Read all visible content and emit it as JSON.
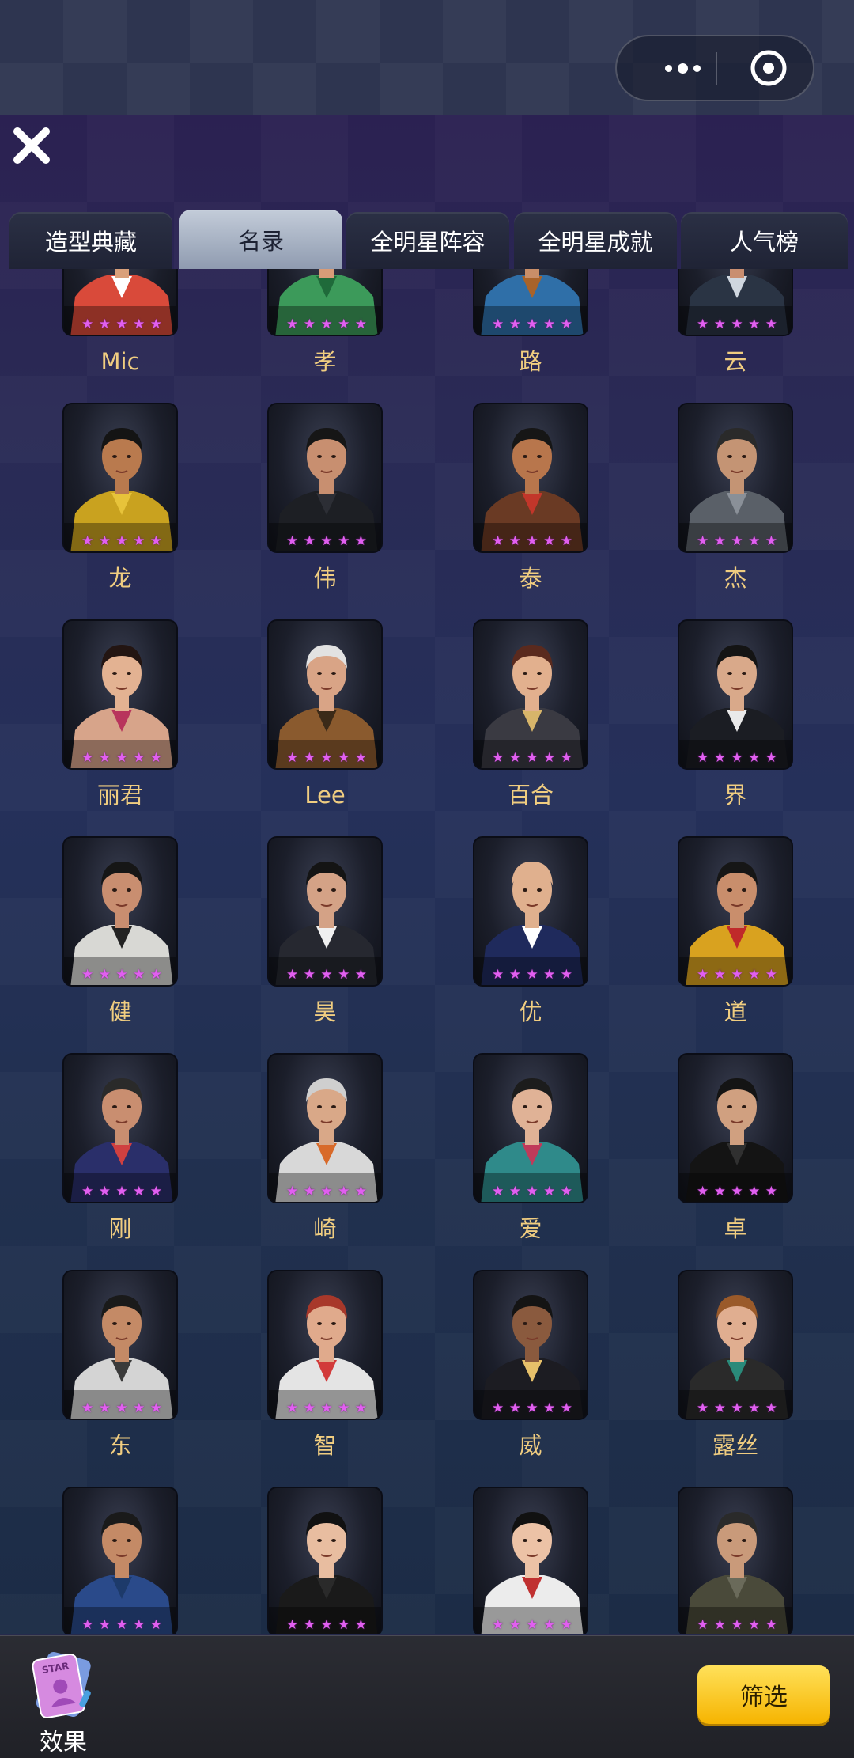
{
  "tabs": [
    {
      "label": "造型典藏"
    },
    {
      "label": "名录",
      "active": true
    },
    {
      "label": "全明星阵容"
    },
    {
      "label": "全明星成就"
    },
    {
      "label": "人气榜"
    }
  ],
  "star_rating": 5,
  "star_color": "#e15ff0",
  "characters": [
    {
      "name": "Mic"
    },
    {
      "name": "孝"
    },
    {
      "name": "路"
    },
    {
      "name": "云"
    },
    {
      "name": "龙"
    },
    {
      "name": "伟"
    },
    {
      "name": "泰"
    },
    {
      "name": "杰"
    },
    {
      "name": "丽君"
    },
    {
      "name": "Lee"
    },
    {
      "name": "百合"
    },
    {
      "name": "界"
    },
    {
      "name": "健"
    },
    {
      "name": "昊"
    },
    {
      "name": "优"
    },
    {
      "name": "道"
    },
    {
      "name": "刚"
    },
    {
      "name": "崎"
    },
    {
      "name": "爱"
    },
    {
      "name": "卓"
    },
    {
      "name": "东"
    },
    {
      "name": "智"
    },
    {
      "name": "威"
    },
    {
      "name": "露丝"
    },
    {
      "name": ""
    },
    {
      "name": ""
    },
    {
      "name": ""
    },
    {
      "name": ""
    }
  ],
  "portrait_palette": [
    {
      "shirt": "#d94a3a",
      "skin": "#d9a07a",
      "hair": "#3a2a20",
      "accent": "#ffffff"
    },
    {
      "shirt": "#3c9a5a",
      "skin": "#d99c78",
      "hair": "#4a2a1a",
      "accent": "#1f6a3a"
    },
    {
      "shirt": "#2f6fa8",
      "skin": "#c98e68",
      "hair": "#8a4a1f",
      "accent": "#a8632a"
    },
    {
      "shirt": "#2a3444",
      "skin": "#c98e70",
      "hair": "#1c1c1c",
      "accent": "#cfd6df"
    },
    {
      "shirt": "#c9a21f",
      "skin": "#b97a4e",
      "hair": "#141414",
      "accent": "#e7c33a"
    },
    {
      "shirt": "#1d1f24",
      "skin": "#c88f70",
      "hair": "#161616",
      "accent": "#2c2e35"
    },
    {
      "shirt": "#6a3a24",
      "skin": "#b8764c",
      "hair": "#161616",
      "accent": "#c2362a"
    },
    {
      "shirt": "#5a6068",
      "skin": "#c49474",
      "hair": "#2a2a2a",
      "accent": "#8a9098"
    },
    {
      "shirt": "#d7a48a",
      "skin": "#e3b292",
      "hair": "#231512",
      "accent": "#b8345c"
    },
    {
      "shirt": "#8a5a2e",
      "skin": "#d9a486",
      "hair": "#e2e2e2",
      "accent": "#3b2a18"
    },
    {
      "shirt": "#3a3a42",
      "skin": "#e2b08e",
      "hair": "#5a2a1e",
      "accent": "#d7b56a"
    },
    {
      "shirt": "#1b1d23",
      "skin": "#d9a98a",
      "hair": "#141414",
      "accent": "#e9e9e9"
    },
    {
      "shirt": "#d8d8d4",
      "skin": "#c98e70",
      "hair": "#161616",
      "accent": "#222222"
    },
    {
      "shirt": "#262830",
      "skin": "#d4a286",
      "hair": "#141414",
      "accent": "#f0f0f0"
    },
    {
      "shirt": "#1f2a5c",
      "skin": "#e0b08e",
      "hair": "#e0b08e",
      "accent": "#ffffff"
    },
    {
      "shirt": "#d9a21f",
      "skin": "#c98e6c",
      "hair": "#161616",
      "accent": "#c02a2a"
    },
    {
      "shirt": "#2a2f6a",
      "skin": "#c98e70",
      "hair": "#2a2a2a",
      "accent": "#d04040"
    },
    {
      "shirt": "#d8d8d8",
      "skin": "#d9a888",
      "hair": "#cfcfcf",
      "accent": "#d86a2a"
    },
    {
      "shirt": "#2f8a8a",
      "skin": "#e0b296",
      "hair": "#1c1c1c",
      "accent": "#c03a5a"
    },
    {
      "shirt": "#141414",
      "skin": "#d0a080",
      "hair": "#141414",
      "accent": "#303030"
    },
    {
      "shirt": "#d4d4d4",
      "skin": "#c48a66",
      "hair": "#1a1a1a",
      "accent": "#3a3a3a"
    },
    {
      "shirt": "#e4e4e4",
      "skin": "#e0aa8c",
      "hair": "#a8382a",
      "accent": "#d23a3a"
    },
    {
      "shirt": "#1c1c22",
      "skin": "#8a5a3e",
      "hair": "#141414",
      "accent": "#e6c06a"
    },
    {
      "shirt": "#2a2a2a",
      "skin": "#e0ae90",
      "hair": "#9a5a2a",
      "accent": "#2a8a7a"
    },
    {
      "shirt": "#2a4a8a",
      "skin": "#c48a66",
      "hair": "#1a1a1a",
      "accent": "#1d3a6a"
    },
    {
      "shirt": "#1a1a1a",
      "skin": "#e8bda0",
      "hair": "#111111",
      "accent": "#2a2a2a"
    },
    {
      "shirt": "#ececec",
      "skin": "#ecc2a6",
      "hair": "#111111",
      "accent": "#c03030"
    },
    {
      "shirt": "#4a4a3a",
      "skin": "#c99a7a",
      "hair": "#2a2a2a",
      "accent": "#6a6a5a"
    }
  ],
  "bottom_bar": {
    "effect_label": "效果",
    "effect_icon_text": "STAR",
    "filter_label": "筛选"
  },
  "colors": {
    "name_text": "#f0cd80",
    "filter_button": "#f6b400",
    "active_tab": "#c3ccd9"
  }
}
